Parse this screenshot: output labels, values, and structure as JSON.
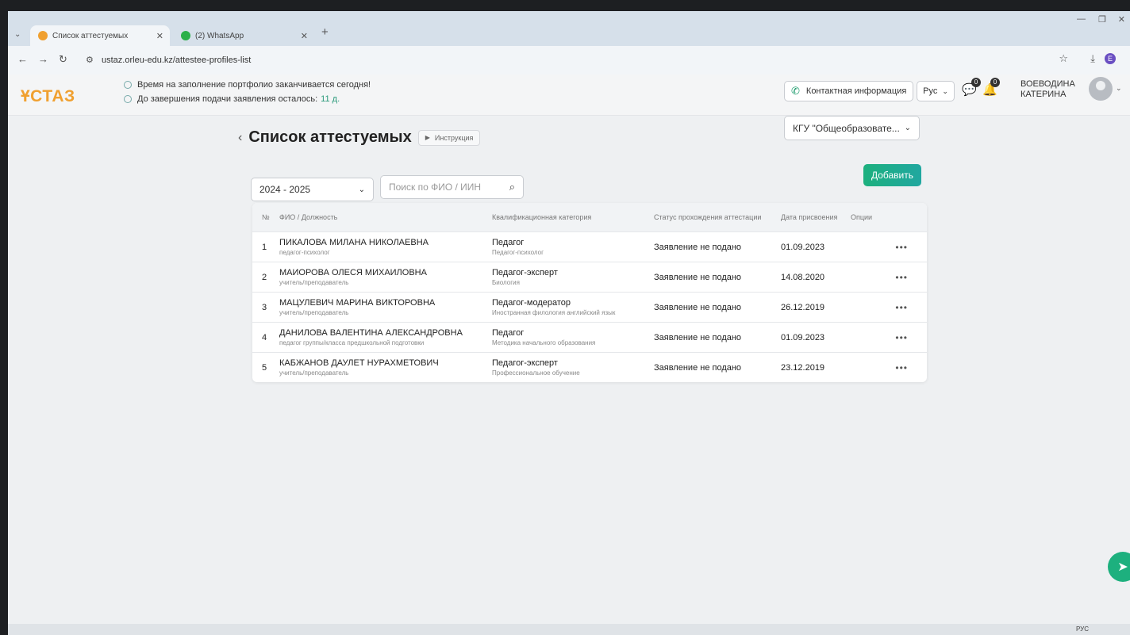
{
  "browser": {
    "tabs": [
      {
        "label": "Список аттестуемых",
        "active": true
      },
      {
        "label": "(2) WhatsApp",
        "active": false
      }
    ],
    "url": "ustaz.orleu-edu.kz/attestee-profiles-list"
  },
  "header": {
    "logo": "ҰСТАЗ",
    "notice_1": "Время на заполнение портфолио заканчивается сегодня!",
    "notice_2": "До завершения подачи заявления осталось:",
    "notice_2_days": "11 д.",
    "contact_label": "Контактная информация",
    "lang": "Рус",
    "messages_count": "0",
    "notifications_count": "0",
    "user_name_line1": "ВОЕВОДИНА",
    "user_name_line2": "КАТЕРИНА"
  },
  "page": {
    "title": "Список аттестуемых",
    "instruction_label": "Инструкция",
    "org_select": "КГУ \"Общеобразовате...",
    "year_select": "2024 - 2025",
    "search_placeholder": "Поиск по ФИО / ИИН",
    "add_label": "Добавить"
  },
  "table": {
    "headers": {
      "num": "№",
      "name": "ФИО / Должность",
      "category": "Квалификационная категория",
      "status": "Статус прохождения аттестации",
      "date": "Дата присвоения",
      "options": "Опции"
    },
    "rows": [
      {
        "num": "1",
        "name": "ПИКАЛОВА МИЛАНА НИКОЛАЕВНА",
        "position": "педагог-психолог",
        "category": "Педагог",
        "subject": "Педагог-психолог",
        "status": "Заявление не подано",
        "date": "01.09.2023"
      },
      {
        "num": "2",
        "name": "МАИОРОВА ОЛЕСЯ МИХАИЛОВНА",
        "position": "учитель/преподаватель",
        "category": "Педагог-эксперт",
        "subject": "Биология",
        "status": "Заявление не подано",
        "date": "14.08.2020"
      },
      {
        "num": "3",
        "name": "МАЦУЛЕВИЧ МАРИНА ВИКТОРОВНА",
        "position": "учитель/преподаватель",
        "category": "Педагог-модератор",
        "subject": "Иностранная филология английский язык",
        "status": "Заявление не подано",
        "date": "26.12.2019"
      },
      {
        "num": "4",
        "name": "ДАНИЛОВА ВАЛЕНТИНА АЛЕКСАНДРОВНА",
        "position": "педагог группы/класса предшкольной подготовки",
        "category": "Педагог",
        "subject": "Методика начального образования",
        "status": "Заявление не подано",
        "date": "01.09.2023"
      },
      {
        "num": "5",
        "name": "КАБЖАНОВ ДАУЛЕТ НУРАХМЕТОВИЧ",
        "position": "учитель/преподаватель",
        "category": "Педагог-эксперт",
        "subject": "Профессиональное обучение",
        "status": "Заявление не подано",
        "date": "23.12.2019"
      }
    ]
  },
  "taskbar": {
    "lang": "РУС"
  }
}
